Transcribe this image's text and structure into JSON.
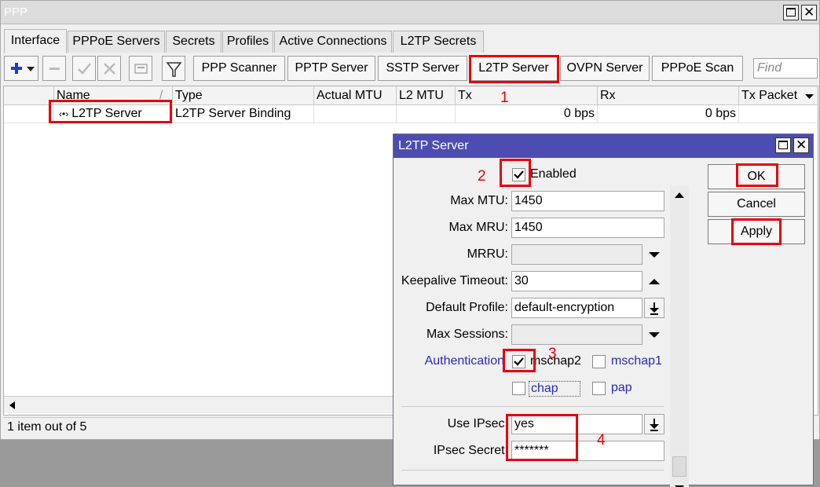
{
  "window": {
    "title": "PPP"
  },
  "tabs": [
    "Interface",
    "PPPoE Servers",
    "Secrets",
    "Profiles",
    "Active Connections",
    "L2TP Secrets"
  ],
  "toolbar": {
    "buttons": [
      "PPP Scanner",
      "PPTP Server",
      "SSTP Server",
      "L2TP Server",
      "OVPN Server",
      "PPPoE Scan"
    ],
    "find_placeholder": "Find"
  },
  "table": {
    "columns": [
      "Name",
      "Type",
      "Actual MTU",
      "L2 MTU",
      "Tx",
      "Rx",
      "Tx Packet ("
    ],
    "rows": [
      {
        "name": "L2TP Server",
        "type": "L2TP Server Binding",
        "actual_mtu": "",
        "l2_mtu": "",
        "tx": "0 bps",
        "rx": "0 bps",
        "tx_packet": ""
      }
    ]
  },
  "status": {
    "text": "1 item out of 5"
  },
  "dialog": {
    "title": "L2TP Server",
    "enabled_label": "Enabled",
    "enabled": true,
    "max_mtu_label": "Max MTU:",
    "max_mtu": "1450",
    "max_mru_label": "Max MRU:",
    "max_mru": "1450",
    "mrru_label": "MRRU:",
    "mrru": "",
    "keepalive_label": "Keepalive Timeout:",
    "keepalive": "30",
    "default_profile_label": "Default Profile:",
    "default_profile": "default-encryption",
    "max_sessions_label": "Max Sessions:",
    "max_sessions": "",
    "authentication_label": "Authentication",
    "auth": [
      {
        "label": "mschap2",
        "checked": true
      },
      {
        "label": "mschap1",
        "checked": false
      },
      {
        "label": "chap",
        "checked": false
      },
      {
        "label": "pap",
        "checked": false
      }
    ],
    "use_ipsec_label": "Use IPsec:",
    "use_ipsec": "yes",
    "ipsec_secret_label": "IPsec Secret:",
    "ipsec_secret": "*******",
    "buttons": {
      "ok": "OK",
      "cancel": "Cancel",
      "apply": "Apply"
    }
  },
  "annotations": [
    "1",
    "2",
    "3",
    "4"
  ],
  "colors": {
    "highlight": "#e8000b",
    "dialog_title": "#4d4db1",
    "link": "#2a2ab8",
    "add_icon": "#1b3fc4"
  }
}
